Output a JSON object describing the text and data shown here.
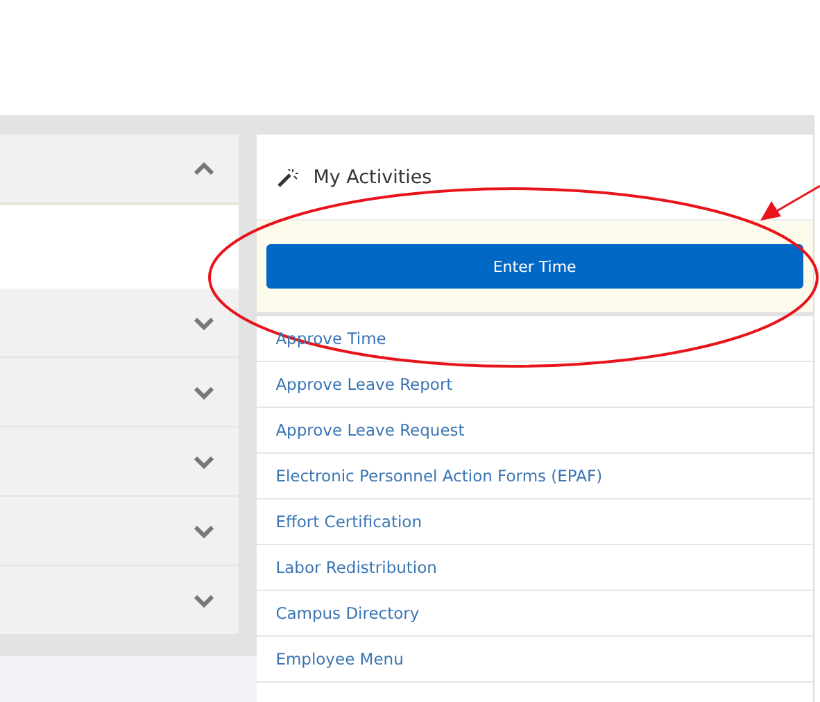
{
  "accordions": [
    {
      "expanded": true
    },
    {
      "expanded": false
    },
    {
      "expanded": false
    },
    {
      "expanded": false
    },
    {
      "expanded": false
    },
    {
      "expanded": false
    }
  ],
  "activities": {
    "title": "My Activities",
    "primary_button": "Enter Time",
    "links": [
      "Approve Time",
      "Approve Leave Report",
      "Approve Leave Request",
      "Electronic Personnel Action Forms (EPAF)",
      "Effort Certification",
      "Labor Redistribution",
      "Campus Directory",
      "Employee Menu"
    ]
  }
}
